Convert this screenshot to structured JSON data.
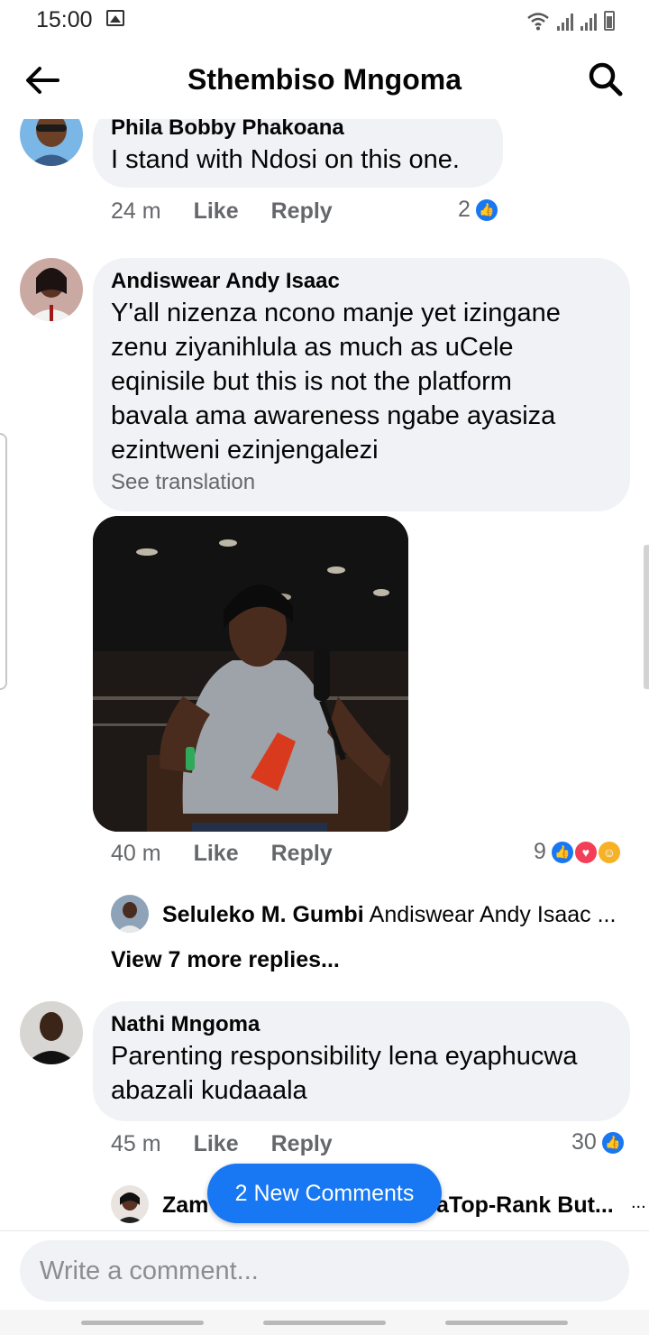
{
  "status_bar": {
    "time": "15:00"
  },
  "header": {
    "title": "Sthembiso Mngoma"
  },
  "comments": [
    {
      "author": "Phila Bobby Phakoana",
      "text": "I stand with Ndosi on this one.",
      "time": "24 m",
      "like_label": "Like",
      "reply_label": "Reply",
      "reaction_count": "2"
    },
    {
      "author": "Andiswear Andy Isaac",
      "text_lines": [
        "Y'all nizenza ncono manje yet izingane",
        "zenu ziyanihlula as much as uCele",
        "eqinisile but this is not the platform",
        "bavala ama awareness ngabe ayasiza",
        "ezintweni ezinjengalezi"
      ],
      "see_translation": "See translation",
      "time": "40 m",
      "like_label": "Like",
      "reply_label": "Reply",
      "reaction_count": "9",
      "reply_preview": {
        "author": "Seluleko M. Gumbi",
        "text": "Andiswear Andy Isaac ..."
      },
      "view_more": "View 7 more replies..."
    },
    {
      "author": "Nathi Mngoma",
      "text_lines": [
        "Parenting responsibility lena eyaphucwa",
        "abazali kudaaala"
      ],
      "time": "45 m",
      "like_label": "Like",
      "reply_label": "Reply",
      "reaction_count": "30",
      "reply_preview": {
        "author_start": "Zam",
        "author_end": "aTop-Rank But...",
        "more": "..."
      }
    }
  ],
  "new_comments_pill": "2 New Comments",
  "composer": {
    "placeholder": "Write a comment..."
  },
  "colors": {
    "accent": "#1877f2",
    "bubble": "#f0f2f5",
    "muted": "#65676b"
  }
}
